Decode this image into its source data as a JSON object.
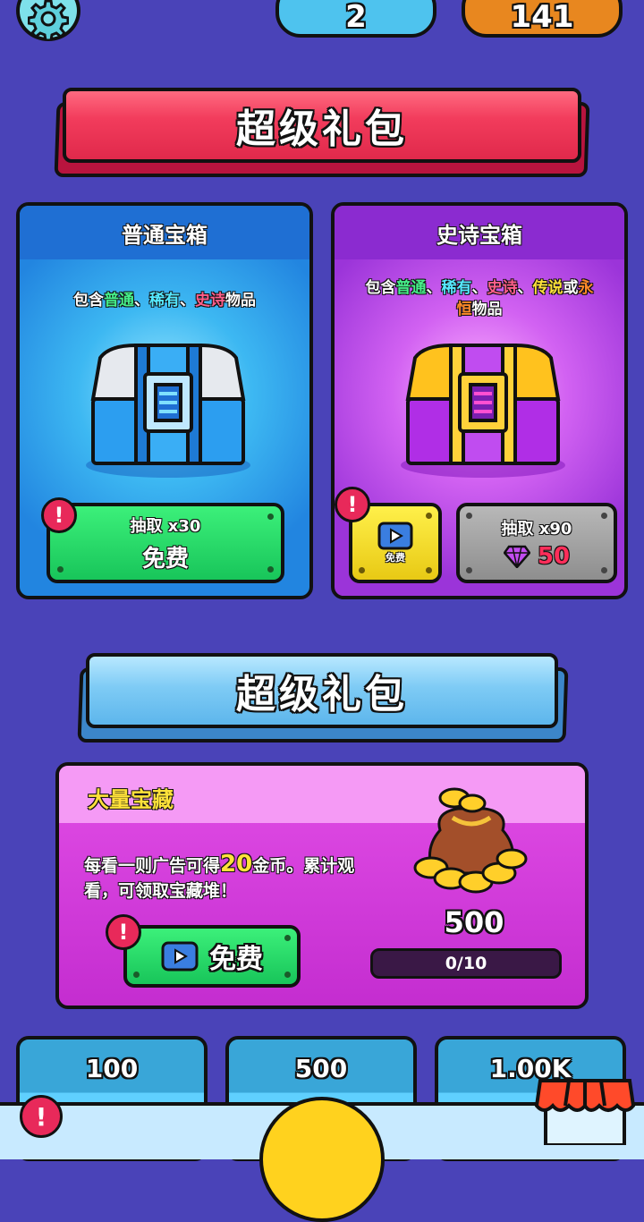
{
  "top": {
    "settings_icon": "gear-icon",
    "ticket_count": "2",
    "coin_count": "141"
  },
  "banner_top": {
    "title": "超级礼包"
  },
  "normal_chest": {
    "title": "普通宝箱",
    "desc_prefix": "包含",
    "desc_r1": "普通",
    "desc_sep1": "、",
    "desc_r2": "稀有",
    "desc_sep2": "、",
    "desc_r3": "史诗",
    "desc_suffix": "物品",
    "draw_label": "抽取 x30",
    "free_label": "免费"
  },
  "epic_chest": {
    "title": "史诗宝箱",
    "desc_prefix": "包含",
    "desc_r1": "普通",
    "desc_sep1": "、",
    "desc_r2": "稀有",
    "desc_sep2": "、",
    "desc_r3": "史诗",
    "desc_sep3": "、",
    "desc_r4": "传说",
    "desc_or": "或",
    "desc_r5": "永",
    "desc_r5b": "恒",
    "desc_suffix": "物品",
    "ad_free_label": "免费",
    "draw_label": "抽取 x90",
    "gem_price": "50"
  },
  "banner_mid": {
    "title": "超级礼包"
  },
  "treasure": {
    "title": "大量宝藏",
    "desc_a": "每看一则广告可得",
    "desc_amount": "20",
    "desc_b": "金币。累计观",
    "desc_c": "看，可领取宝藏堆！",
    "free_label": "免费",
    "reward": "500",
    "progress_text": "0/10",
    "progress_value": 0
  },
  "packs": [
    {
      "amount": "100"
    },
    {
      "amount": "500"
    },
    {
      "amount": "1.00K"
    }
  ],
  "colors": {
    "background": "#4a43b8",
    "red_banner": "#f23c5c",
    "blue_banner": "#7ecbf5",
    "green_button": "#2bdc6a",
    "alert": "#e8295a"
  }
}
